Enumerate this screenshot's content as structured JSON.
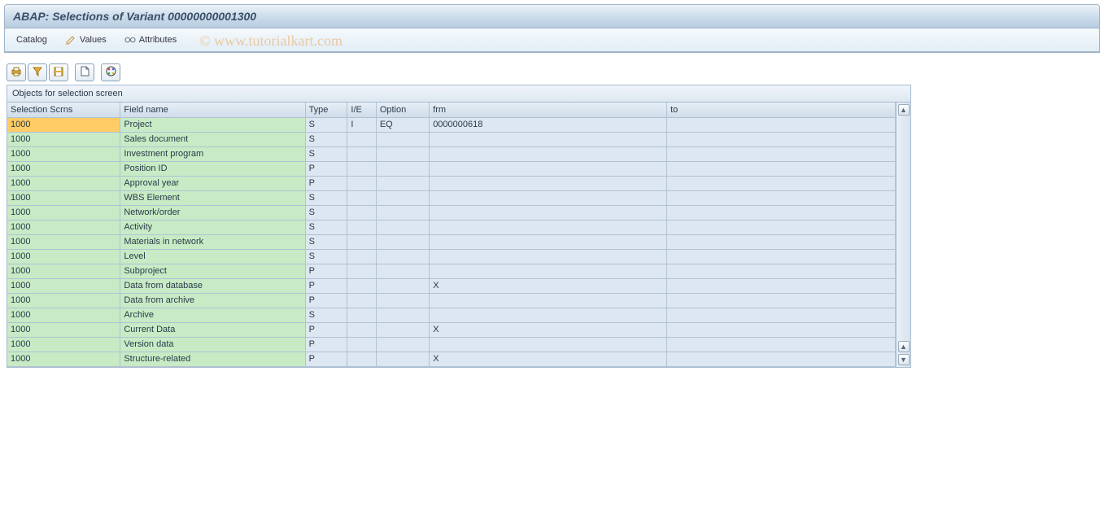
{
  "window": {
    "title": "ABAP: Selections of Variant 00000000001300"
  },
  "menu": {
    "catalog": "Catalog",
    "values": "Values",
    "attributes": "Attributes"
  },
  "panel": {
    "header": "Objects for selection screen"
  },
  "columns": {
    "scrn": "Selection Scrns",
    "field": "Field name",
    "type": "Type",
    "ie": "I/E",
    "opt": "Option",
    "frm": "frm",
    "to": "to"
  },
  "rows": [
    {
      "scrn": "1000",
      "field": "Project",
      "type": "S",
      "ie": "I",
      "opt": "EQ",
      "frm": "0000000618",
      "to": "",
      "selected": true
    },
    {
      "scrn": "1000",
      "field": "Sales document",
      "type": "S",
      "ie": "",
      "opt": "",
      "frm": "",
      "to": ""
    },
    {
      "scrn": "1000",
      "field": "Investment program",
      "type": "S",
      "ie": "",
      "opt": "",
      "frm": "",
      "to": ""
    },
    {
      "scrn": "1000",
      "field": "Position ID",
      "type": "P",
      "ie": "",
      "opt": "",
      "frm": "",
      "to": ""
    },
    {
      "scrn": "1000",
      "field": "Approval year",
      "type": "P",
      "ie": "",
      "opt": "",
      "frm": "",
      "to": ""
    },
    {
      "scrn": "1000",
      "field": "WBS Element",
      "type": "S",
      "ie": "",
      "opt": "",
      "frm": "",
      "to": ""
    },
    {
      "scrn": "1000",
      "field": "Network/order",
      "type": "S",
      "ie": "",
      "opt": "",
      "frm": "",
      "to": ""
    },
    {
      "scrn": "1000",
      "field": "Activity",
      "type": "S",
      "ie": "",
      "opt": "",
      "frm": "",
      "to": ""
    },
    {
      "scrn": "1000",
      "field": "Materials in network",
      "type": "S",
      "ie": "",
      "opt": "",
      "frm": "",
      "to": ""
    },
    {
      "scrn": "1000",
      "field": "Level",
      "type": "S",
      "ie": "",
      "opt": "",
      "frm": "",
      "to": ""
    },
    {
      "scrn": "1000",
      "field": "Subproject",
      "type": "P",
      "ie": "",
      "opt": "",
      "frm": "",
      "to": ""
    },
    {
      "scrn": "1000",
      "field": "Data from database",
      "type": "P",
      "ie": "",
      "opt": "",
      "frm": "X",
      "to": ""
    },
    {
      "scrn": "1000",
      "field": "Data from archive",
      "type": "P",
      "ie": "",
      "opt": "",
      "frm": "",
      "to": ""
    },
    {
      "scrn": "1000",
      "field": "Archive",
      "type": "S",
      "ie": "",
      "opt": "",
      "frm": "",
      "to": ""
    },
    {
      "scrn": "1000",
      "field": "Current Data",
      "type": "P",
      "ie": "",
      "opt": "",
      "frm": "X",
      "to": ""
    },
    {
      "scrn": "1000",
      "field": "Version data",
      "type": "P",
      "ie": "",
      "opt": "",
      "frm": "",
      "to": ""
    },
    {
      "scrn": "1000",
      "field": "Structure-related",
      "type": "P",
      "ie": "",
      "opt": "",
      "frm": "X",
      "to": ""
    }
  ],
  "watermark": "© www.tutorialkart.com"
}
